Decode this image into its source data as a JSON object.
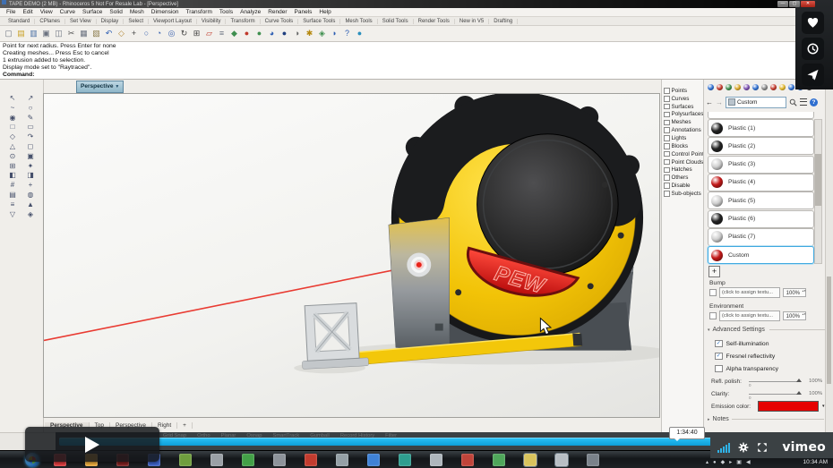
{
  "window": {
    "title": "TAPE DEMO (2 MB) - Rhinoceros 5 Not For Resale Lab - [Perspective]",
    "controls": {
      "minimize": "—",
      "maximize": "▢",
      "close": "✕"
    }
  },
  "menu_bar": {
    "items": [
      "File",
      "Edit",
      "View",
      "Curve",
      "Surface",
      "Solid",
      "Mesh",
      "Dimension",
      "Transform",
      "Tools",
      "Analyze",
      "Render",
      "Panels",
      "Help"
    ]
  },
  "toolbar_tabs": {
    "items": [
      "Standard",
      "CPlanes",
      "Set View",
      "Display",
      "Select",
      "Viewport Layout",
      "Visibility",
      "Transform",
      "Curve Tools",
      "Surface Tools",
      "Mesh Tools",
      "Solid Tools",
      "Render Tools",
      "New in V5",
      "Drafting"
    ]
  },
  "main_toolbar": {
    "icons": [
      {
        "g": "▢",
        "c": "#6b7280"
      },
      {
        "g": "▤",
        "c": "#c9a227"
      },
      {
        "g": "▥",
        "c": "#4a6fa5"
      },
      {
        "g": "▣",
        "c": "#6b7280"
      },
      {
        "g": "◫",
        "c": "#6b7280"
      },
      {
        "g": "✂",
        "c": "#555555"
      },
      {
        "g": "▦",
        "c": "#6b7280"
      },
      {
        "g": "▧",
        "c": "#8a7a4a"
      },
      {
        "g": "↶",
        "c": "#2f5fb3"
      },
      {
        "g": "◇",
        "c": "#b58a3a"
      },
      {
        "g": "+",
        "c": "#444444"
      },
      {
        "g": "○",
        "c": "#365fae"
      },
      {
        "g": "◔",
        "c": "#365fae"
      },
      {
        "g": "◎",
        "c": "#365fae"
      },
      {
        "g": "↻",
        "c": "#444444"
      },
      {
        "g": "⊞",
        "c": "#444444"
      },
      {
        "g": "▱",
        "c": "#c0392b"
      },
      {
        "g": "≡",
        "c": "#6b7280"
      },
      {
        "g": "◆",
        "c": "#3f8f4f"
      },
      {
        "g": "●",
        "c": "#c0392b"
      },
      {
        "g": "●",
        "c": "#3f8f4f"
      },
      {
        "g": "◕",
        "c": "#2f5fb3"
      },
      {
        "g": "●",
        "c": "#1f3f7f"
      },
      {
        "g": "◑",
        "c": "#666666"
      },
      {
        "g": "✱",
        "c": "#b5890f"
      },
      {
        "g": "◈",
        "c": "#3f8f4f"
      },
      {
        "g": "◗",
        "c": "#2f5fb3"
      },
      {
        "g": "?",
        "c": "#2f5fb3"
      },
      {
        "g": "●",
        "c": "#2a8fbd"
      }
    ]
  },
  "command_area": {
    "lines": [
      {
        "text": "Point for next radius. Press Enter for none"
      },
      {
        "text": "Creating meshes... Press Esc to cancel"
      },
      {
        "text": "1 extrusion added to selection."
      },
      {
        "text": "Display mode set to \"Raytraced\"."
      },
      {
        "text": "Command:",
        "selected": true
      }
    ]
  },
  "left_toolbox": {
    "icons": [
      "↖",
      "↗",
      "~",
      "○",
      "◉",
      "✎",
      "□",
      "▭",
      "◇",
      "↷",
      "△",
      "◻",
      "⊙",
      "▣",
      "⊞",
      "✦",
      "◧",
      "◨",
      "#",
      "+",
      "▤",
      "◍",
      "≡",
      "▲",
      "▽",
      "◈"
    ]
  },
  "viewport": {
    "active_tab": "Perspective",
    "tab_caret": "▼",
    "model_logo": "PEW",
    "bottom_tabs": [
      {
        "label": "Perspective",
        "selected": true
      },
      {
        "label": "Top"
      },
      {
        "label": "Perspective"
      },
      {
        "label": "Right"
      },
      {
        "label": "+"
      }
    ]
  },
  "selection_filter": {
    "items": [
      "Points",
      "Curves",
      "Surfaces",
      "Polysurfaces",
      "Meshes",
      "Annotations",
      "Lights",
      "Blocks",
      "Control Points",
      "Point Clouds",
      "Hatches",
      "Others",
      "Disable",
      "Sub-objects"
    ]
  },
  "material_panel": {
    "toolbar_dots": [
      {
        "c": "#2f6fd0"
      },
      {
        "c": "#c23b2e"
      },
      {
        "c": "#3f8f4f"
      },
      {
        "c": "#d9a52a"
      },
      {
        "c": "#7a4fb0"
      },
      {
        "c": "#2f6fd0"
      },
      {
        "c": "#888888"
      },
      {
        "c": "#c23b2e"
      },
      {
        "c": "#e0b52a"
      },
      {
        "c": "#2f6fd0"
      },
      {
        "c": "#2f6fd0"
      },
      {
        "c": "#555555"
      }
    ],
    "nav": {
      "back": "←",
      "forward": "→",
      "search_value": "Custom",
      "help": "?"
    },
    "materials": [
      {
        "label": "Plastic (1)",
        "color": "#232323"
      },
      {
        "label": "Plastic (2)",
        "color": "#232323"
      },
      {
        "label": "Plastic (3)",
        "color": "#cfcfcf"
      },
      {
        "label": "Plastic (4)",
        "color": "#c41a1a"
      },
      {
        "label": "Plastic (5)",
        "color": "#cfcfcf"
      },
      {
        "label": "Plastic (6)",
        "color": "#232323"
      },
      {
        "label": "Plastic (7)",
        "color": "#cfcfcf"
      },
      {
        "label": "Custom",
        "color": "#c41a1a",
        "selected": true
      }
    ],
    "add_button": "+",
    "bump": {
      "label": "Bump",
      "assign_text": "(click to assign textu...",
      "percent": "100%"
    },
    "environment": {
      "label": "Environment",
      "assign_text": "(click to assign textu...",
      "percent": "100%"
    },
    "advanced": {
      "header": "Advanced Settings",
      "checkboxes": [
        {
          "label": "Self-illumination",
          "checked": true
        },
        {
          "label": "Fresnel reflectivity",
          "checked": true
        },
        {
          "label": "Alpha transparency",
          "checked": false
        }
      ],
      "sliders": [
        {
          "label": "Refl. polish:",
          "min": "0",
          "value": "100%"
        },
        {
          "label": "Clarity:",
          "min": "0",
          "value": "100%"
        }
      ],
      "emission_label": "Emission color:",
      "emission_color": "#e60000"
    },
    "notes_header": "Notes"
  },
  "status_bar": {
    "items": [
      "Grid Snap",
      "Ortho",
      "Planar",
      "Osnap",
      "SmartTrack",
      "Gumball",
      "Record History",
      "Filter"
    ]
  },
  "player": {
    "timestamp": "1:34:40",
    "brand": "vimeo",
    "icons": [
      "volume-icon",
      "settings-gear-icon",
      "fullscreen-icon",
      "play-icon"
    ]
  },
  "overlay_buttons": [
    {
      "name": "like-button",
      "icon": "heart-icon"
    },
    {
      "name": "watch-later-button",
      "icon": "clock-icon"
    },
    {
      "name": "share-button",
      "icon": "paper-plane-icon"
    }
  ],
  "taskbar": {
    "icons": [
      {
        "c": "#d8393b"
      },
      {
        "c": "#e7a83b"
      },
      {
        "c": "#7b1f1f"
      },
      {
        "c": "#3b5fc2"
      },
      {
        "c": "#6f9e3e"
      },
      {
        "c": "#9aa0a6"
      },
      {
        "c": "#43a047"
      },
      {
        "c": "#8d939a"
      },
      {
        "c": "#c23b2e"
      },
      {
        "c": "#95a0a6"
      },
      {
        "c": "#3f82d6"
      },
      {
        "c": "#2e9e8f"
      },
      {
        "c": "#aeb6bc"
      },
      {
        "c": "#c0443a"
      },
      {
        "c": "#4fa65a"
      },
      {
        "c": "#d9c35c",
        "pressed": true
      },
      {
        "c": "#b8bec4",
        "pressed": true
      },
      {
        "c": "#7a828a"
      }
    ],
    "tray_icons": [
      "▴",
      "●",
      "◆",
      "▸",
      "▣",
      "◀"
    ],
    "clock": "10:34 AM"
  }
}
